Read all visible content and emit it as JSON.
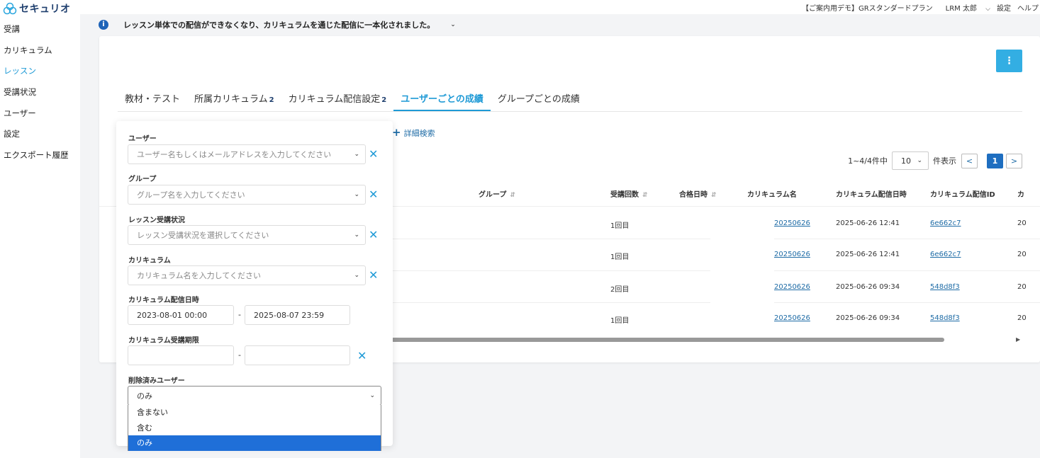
{
  "app": {
    "logo_text": "セキュリオ"
  },
  "sidebar": {
    "items": [
      {
        "label": "受講",
        "active": false
      },
      {
        "label": "カリキュラム",
        "active": false
      },
      {
        "label": "レッスン",
        "active": true
      },
      {
        "label": "受講状況",
        "active": false
      },
      {
        "label": "ユーザー",
        "active": false
      },
      {
        "label": "設定",
        "active": false
      },
      {
        "label": "エクスポート履歴",
        "active": false
      }
    ]
  },
  "topbar": {
    "plan": "【ご案内用デモ】GRスタンダードプラン",
    "user": "LRM 太郎",
    "settings": "設定",
    "help": "ヘルプ"
  },
  "notice": {
    "text": "レッスン単体での配信ができなくなり、カリキュラムを通じた配信に一本化されました。"
  },
  "tabs": [
    {
      "label": "教材・テスト",
      "badge": ""
    },
    {
      "label": "所属カリキュラム",
      "badge": "2"
    },
    {
      "label": "カリキュラム配信設定",
      "badge": "2"
    },
    {
      "label": "ユーザーごとの成績",
      "badge": "",
      "active": true
    },
    {
      "label": "グループごとの成績",
      "badge": ""
    }
  ],
  "detail_search": "詳細検索",
  "pager": {
    "range": "1~4/4件中",
    "per_page": "10",
    "per_page_suffix": "件表示",
    "prev": "<",
    "current": "1",
    "next": ">"
  },
  "table": {
    "headers": {
      "group": "グループ",
      "attempts": "受講回数",
      "pass_date": "合格日時",
      "curriculum_name": "カリキュラム名",
      "delivery_date": "カリキュラム配信日時",
      "delivery_id": "カリキュラム配信ID",
      "next": "カ"
    },
    "rows": [
      {
        "attempts": "1回目",
        "curriculum_name": "20250626",
        "delivery_date": "2025-06-26 12:41",
        "delivery_id": "6e662c7",
        "next": "20"
      },
      {
        "attempts": "1回目",
        "curriculum_name": "20250626",
        "delivery_date": "2025-06-26 12:41",
        "delivery_id": "6e662c7",
        "next": "20"
      },
      {
        "attempts": "2回目",
        "curriculum_name": "20250626",
        "delivery_date": "2025-06-26 09:34",
        "delivery_id": "548d8f3",
        "next": "20"
      },
      {
        "attempts": "1回目",
        "curriculum_name": "20250626",
        "delivery_date": "2025-06-26 09:34",
        "delivery_id": "548d8f3",
        "next": "20"
      }
    ]
  },
  "filter": {
    "user_label": "ユーザー",
    "user_placeholder": "ユーザー名もしくはメールアドレスを入力してください",
    "group_label": "グループ",
    "group_placeholder": "グループ名を入力してください",
    "status_label": "レッスン受講状況",
    "status_placeholder": "レッスン受講状況を選択してください",
    "curriculum_label": "カリキュラム",
    "curriculum_placeholder": "カリキュラム名を入力してください",
    "delivery_date_label": "カリキュラム配信日時",
    "delivery_from": "2023-08-01 00:00",
    "delivery_to": "2025-08-07 23:59",
    "period_label": "カリキュラム受講期限",
    "period_from": "",
    "period_to": "",
    "deleted_label": "削除済みユーザー",
    "deleted_value": "のみ",
    "deleted_options": [
      "含まない",
      "含む",
      "のみ"
    ]
  }
}
